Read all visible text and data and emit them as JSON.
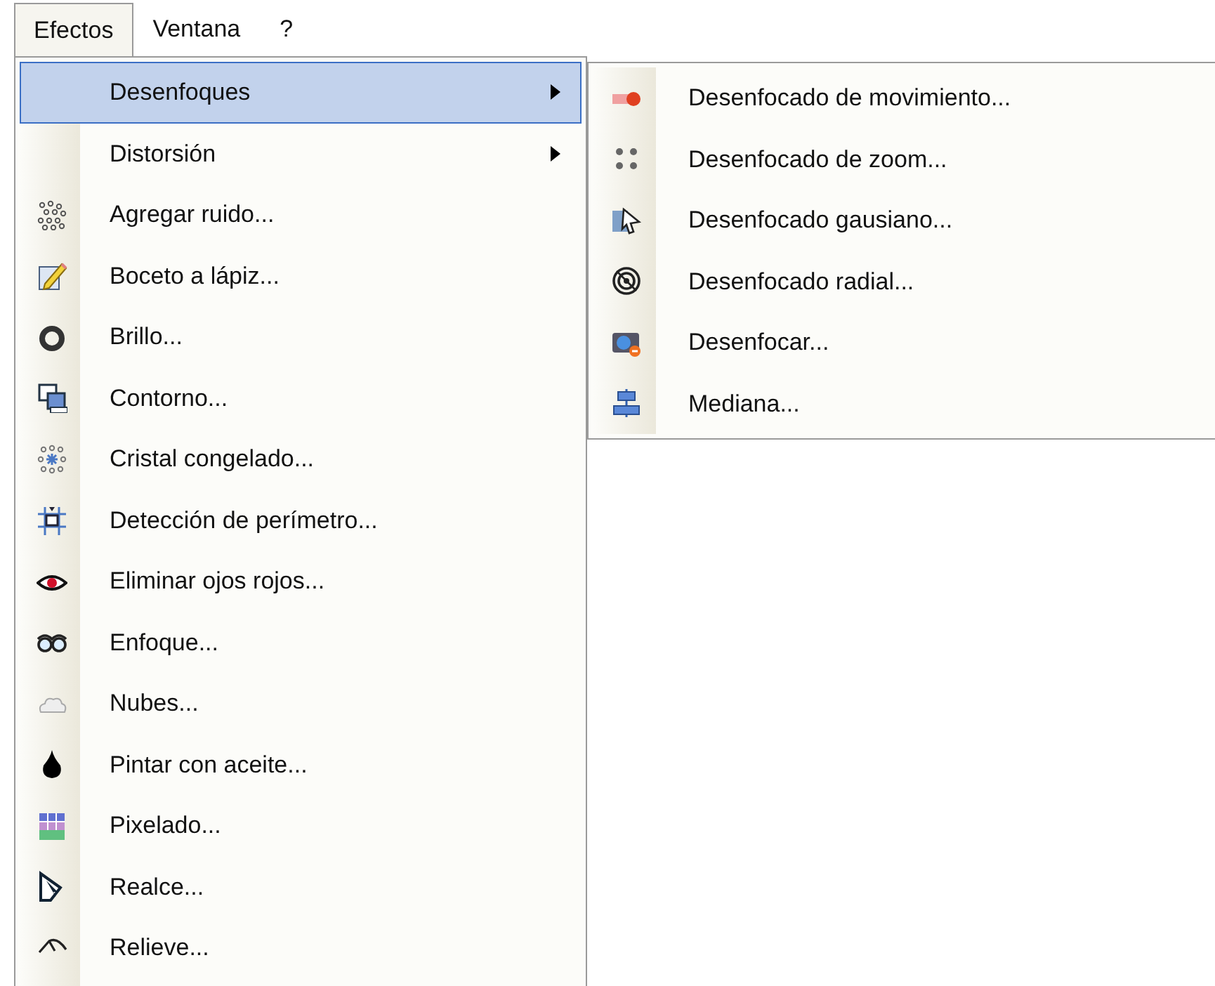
{
  "menubar": [
    {
      "label": "Efectos",
      "selected": true
    },
    {
      "label": "Ventana",
      "selected": false
    },
    {
      "label": "?",
      "selected": false
    }
  ],
  "menu": {
    "items": [
      {
        "label": "Desenfoques",
        "submenu": true,
        "selected": true
      },
      {
        "label": "Distorsión",
        "submenu": true,
        "selected": false
      },
      {
        "label": "Agregar ruido...",
        "submenu": false,
        "selected": false
      },
      {
        "label": "Boceto a lápiz...",
        "submenu": false,
        "selected": false
      },
      {
        "label": "Brillo...",
        "submenu": false,
        "selected": false
      },
      {
        "label": "Contorno...",
        "submenu": false,
        "selected": false
      },
      {
        "label": "Cristal congelado...",
        "submenu": false,
        "selected": false
      },
      {
        "label": "Detección de perímetro...",
        "submenu": false,
        "selected": false
      },
      {
        "label": "Eliminar ojos rojos...",
        "submenu": false,
        "selected": false
      },
      {
        "label": "Enfoque...",
        "submenu": false,
        "selected": false
      },
      {
        "label": "Nubes...",
        "submenu": false,
        "selected": false
      },
      {
        "label": "Pintar con aceite...",
        "submenu": false,
        "selected": false
      },
      {
        "label": "Pixelado...",
        "submenu": false,
        "selected": false
      },
      {
        "label": "Realce...",
        "submenu": false,
        "selected": false
      },
      {
        "label": "Relieve...",
        "submenu": false,
        "selected": false
      }
    ]
  },
  "submenu": {
    "items": [
      {
        "label": "Desenfocado de movimiento...",
        "selected": false
      },
      {
        "label": "Desenfocado de zoom...",
        "selected": false
      },
      {
        "label": "Desenfocado gausiano...",
        "selected": false
      },
      {
        "label": "Desenfocado radial...",
        "selected": false
      },
      {
        "label": "Desenfocar...",
        "selected": false
      },
      {
        "label": "Mediana...",
        "selected": false
      }
    ]
  }
}
